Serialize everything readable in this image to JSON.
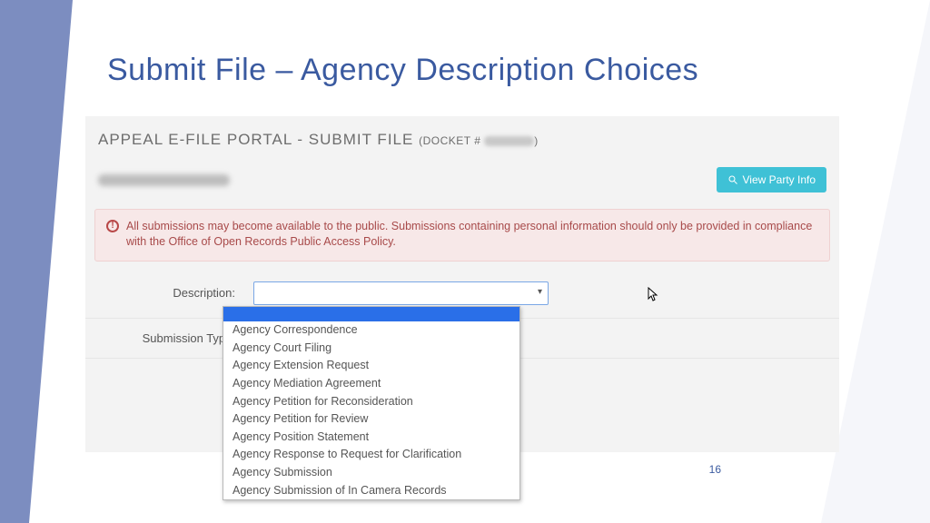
{
  "slide": {
    "title": "Submit File – Agency Description Choices",
    "pageNumber": "16"
  },
  "portal": {
    "heading": "APPEAL E-FILE PORTAL - SUBMIT FILE",
    "docketPrefix": "(DOCKET # ",
    "docketSuffix": ")"
  },
  "buttons": {
    "viewParty": "View Party Info"
  },
  "alert": {
    "text": "All submissions may become available to the public. Submissions containing personal information should only be provided in compliance with the Office of Open Records Public Access Policy."
  },
  "form": {
    "descriptionLabel": "Description:",
    "submissionTypeLabel": "Submission Type:"
  },
  "dropdown": {
    "options": [
      "Agency Correspondence",
      "Agency Court Filing",
      "Agency Extension Request",
      "Agency Mediation Agreement",
      "Agency Petition for Reconsideration",
      "Agency Petition for Review",
      "Agency Position Statement",
      "Agency Response to Request for Clarification",
      "Agency Submission",
      "Agency Submission of In Camera Records"
    ]
  }
}
